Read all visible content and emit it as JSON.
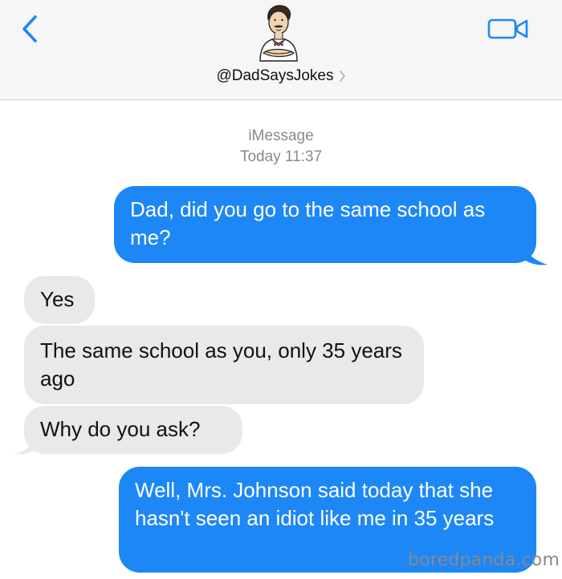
{
  "header": {
    "contact_name": "@DadSaysJokes"
  },
  "meta": {
    "service": "iMessage",
    "timestamp": "Today 11:37"
  },
  "messages": [
    {
      "direction": "outgoing",
      "text": "Dad, did you go to the same school as me?"
    },
    {
      "direction": "incoming",
      "text": "Yes"
    },
    {
      "direction": "incoming",
      "text": "The same school as you, only 35 years ago"
    },
    {
      "direction": "incoming",
      "text": "Why do you ask?"
    },
    {
      "direction": "outgoing",
      "text": "Well, Mrs. Johnson said today that she hasn't seen an idiot like me in 35 years"
    }
  ],
  "watermark": "boredpanda.com",
  "colors": {
    "accent": "#1d87f6",
    "incoming_bubble": "#e9e9eb",
    "header_bg": "#f6f6f6",
    "meta_text": "#8a8a8e"
  },
  "icons": {
    "back": "chevron-left-icon",
    "video": "video-camera-icon",
    "contact_disclosure": "chevron-right-icon"
  }
}
